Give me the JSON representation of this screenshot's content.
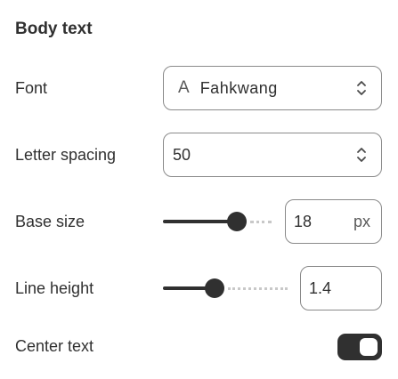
{
  "section": {
    "title": "Body text"
  },
  "font": {
    "label": "Font",
    "glyph": "A",
    "value": "Fahkwang"
  },
  "letter_spacing": {
    "label": "Letter spacing",
    "value": "50"
  },
  "base_size": {
    "label": "Base size",
    "value": "18",
    "unit": "px",
    "slider_fraction": 0.72
  },
  "line_height": {
    "label": "Line height",
    "value": "1.4",
    "slider_fraction": 0.4
  },
  "center_text": {
    "label": "Center text",
    "enabled": true
  },
  "colors": {
    "accent": "#303030",
    "border": "#8a8a8a",
    "track_rest": "#c8c8c8"
  }
}
